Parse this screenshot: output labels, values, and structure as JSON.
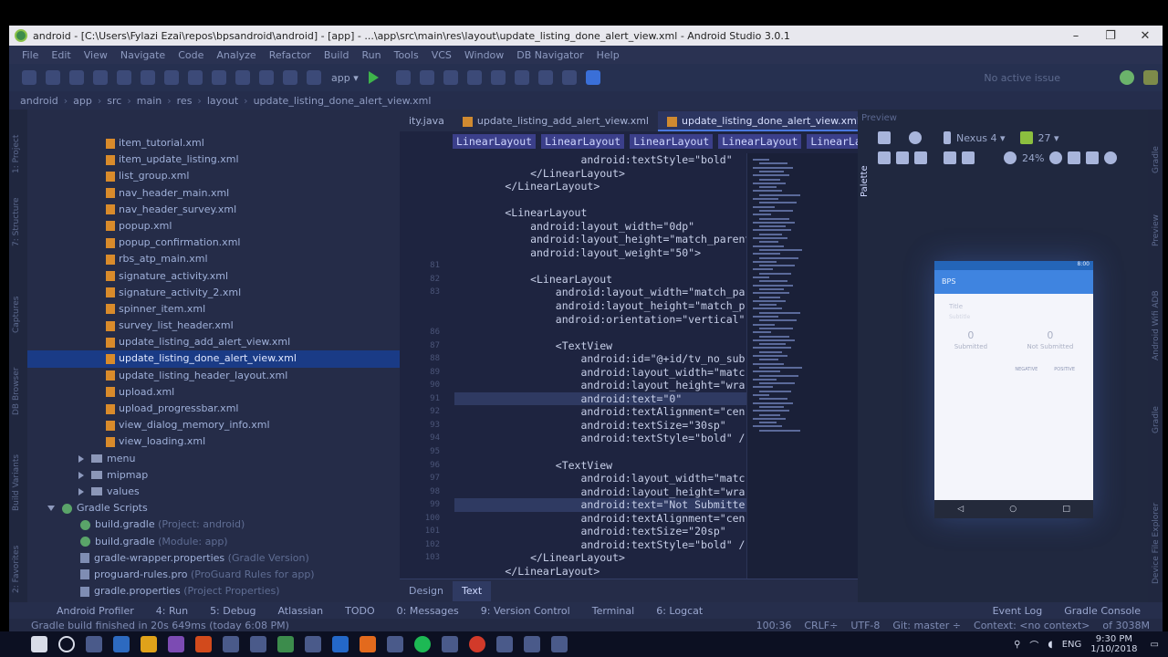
{
  "window": {
    "title": "android - [C:\\Users\\Fylazi Ezai\\repos\\bpsandroid\\android] - [app] - ...\\app\\src\\main\\res\\layout\\update_listing_done_alert_view.xml - Android Studio 3.0.1",
    "minimize": "–",
    "maximize": "❐",
    "close": "✕"
  },
  "menu": [
    "File",
    "Edit",
    "View",
    "Navigate",
    "Code",
    "Analyze",
    "Refactor",
    "Build",
    "Run",
    "Tools",
    "VCS",
    "Window",
    "DB Navigator",
    "Help"
  ],
  "toolbar": {
    "run_config": "app ▾",
    "issue": "No active issue"
  },
  "breadcrumbs": [
    "android",
    "app",
    "src",
    "main",
    "res",
    "layout",
    "update_listing_done_alert_view.xml"
  ],
  "side_tabs_left": [
    "1: Project",
    "7: Structure",
    "Captures",
    "DB Browser",
    "Build Variants",
    "2: Favorites"
  ],
  "side_tabs_right": [
    "Gradle",
    "Preview",
    "Android Wifi ADB",
    "Gradle",
    "Device File Explorer"
  ],
  "project_tree": {
    "files": [
      "item_tutorial.xml",
      "item_update_listing.xml",
      "list_group.xml",
      "nav_header_main.xml",
      "nav_header_survey.xml",
      "popup.xml",
      "popup_confirmation.xml",
      "rbs_atp_main.xml",
      "signature_activity.xml",
      "signature_activity_2.xml",
      "spinner_item.xml",
      "survey_list_header.xml",
      "update_listing_add_alert_view.xml",
      "update_listing_done_alert_view.xml",
      "update_listing_header_layout.xml",
      "upload.xml",
      "upload_progressbar.xml",
      "view_dialog_memory_info.xml",
      "view_loading.xml"
    ],
    "selected_index": 13,
    "folders": [
      "menu",
      "mipmap",
      "values"
    ],
    "gradle_scripts": "Gradle Scripts",
    "gradle_files": [
      {
        "name": "build.gradle",
        "note": "(Project: android)"
      },
      {
        "name": "build.gradle",
        "note": "(Module: app)"
      },
      {
        "name": "gradle-wrapper.properties",
        "note": "(Gradle Version)"
      },
      {
        "name": "proguard-rules.pro",
        "note": "(ProGuard Rules for app)"
      },
      {
        "name": "gradle.properties",
        "note": "(Project Properties)"
      }
    ]
  },
  "editor": {
    "tabs": [
      {
        "label": "ity.java",
        "active": false
      },
      {
        "label": "update_listing_add_alert_view.xml",
        "active": false
      },
      {
        "label": "update_listing_done_alert_view.xml",
        "active": true
      }
    ],
    "tag_breadcrumb": [
      "LinearLayout",
      "LinearLayout",
      "LinearLayout",
      "LinearLayout",
      "LinearLayout"
    ],
    "line_numbers": [
      "",
      "",
      "",
      "",
      "",
      "",
      "",
      "",
      "81",
      "82",
      "83",
      "",
      "",
      "86",
      "87",
      "88",
      "89",
      "90",
      "91",
      "92",
      "93",
      "94",
      "95",
      "96",
      "97",
      "98",
      "99",
      "100",
      "101",
      "102",
      "103"
    ],
    "code_lines": [
      "                    android:textStyle=\"bold\"",
      "            </LinearLayout>",
      "        </LinearLayout>",
      "",
      "        <LinearLayout",
      "            android:layout_width=\"0dp\"",
      "            android:layout_height=\"match_parent\"",
      "            android:layout_weight=\"50\">",
      "",
      "            <LinearLayout",
      "                android:layout_width=\"match_pa",
      "                android:layout_height=\"match_p",
      "                android:orientation=\"vertical\"",
      "",
      "                <TextView",
      "                    android:id=\"@+id/tv_no_sub",
      "                    android:layout_width=\"matc",
      "                    android:layout_height=\"wra",
      "                    android:text=\"0\"",
      "                    android:textAlignment=\"cen",
      "                    android:textSize=\"30sp\"",
      "                    android:textStyle=\"bold\" /",
      "",
      "                <TextView",
      "                    android:layout_width=\"matc",
      "                    android:layout_height=\"wra",
      "                    android:text=\"Not Submitte",
      "                    android:textAlignment=\"cen",
      "                    android:textSize=\"20sp\"",
      "                    android:textStyle=\"bold\" /",
      "            </LinearLayout>",
      "        </LinearLayout>"
    ],
    "highlighted_lines": [
      18,
      26
    ],
    "design_tab": "Design",
    "text_tab": "Text"
  },
  "preview": {
    "header": "Preview",
    "palette": "Palette",
    "device": "Nexus 4 ▾",
    "api": "27 ▾",
    "zoom": "24%",
    "phone": {
      "status_time": "8:00",
      "app_title": "BPS",
      "title_label": "Title",
      "subtitle": "Subtitle",
      "counts": [
        {
          "value": "0",
          "label": "Submitted"
        },
        {
          "value": "0",
          "label": "Not Submitted"
        }
      ],
      "buttons": [
        "NEGATIVE",
        "POSITIVE"
      ],
      "nav": [
        "◁",
        "○",
        "□"
      ]
    }
  },
  "bottom_tools": [
    "Android Profiler",
    "4: Run",
    "5: Debug",
    "Atlassian",
    "TODO",
    "0: Messages",
    "9: Version Control",
    "Terminal",
    "6: Logcat",
    "Event Log",
    "Gradle Console"
  ],
  "status": {
    "message": "Gradle build finished in 20s 649ms (today 6:08 PM)",
    "position": "100:36",
    "line_sep": "CRLF÷",
    "encoding": "UTF-8",
    "git": "Git: master ÷",
    "context": "Context: <no context>",
    "memory": "of 3038M"
  },
  "taskbar": {
    "lang": "ENG",
    "time": "9:30 PM",
    "date": "1/10/2018"
  },
  "colors": {
    "selection": "#1a3b86",
    "accent": "#4a78e0",
    "xml_icon": "#d08a30"
  }
}
